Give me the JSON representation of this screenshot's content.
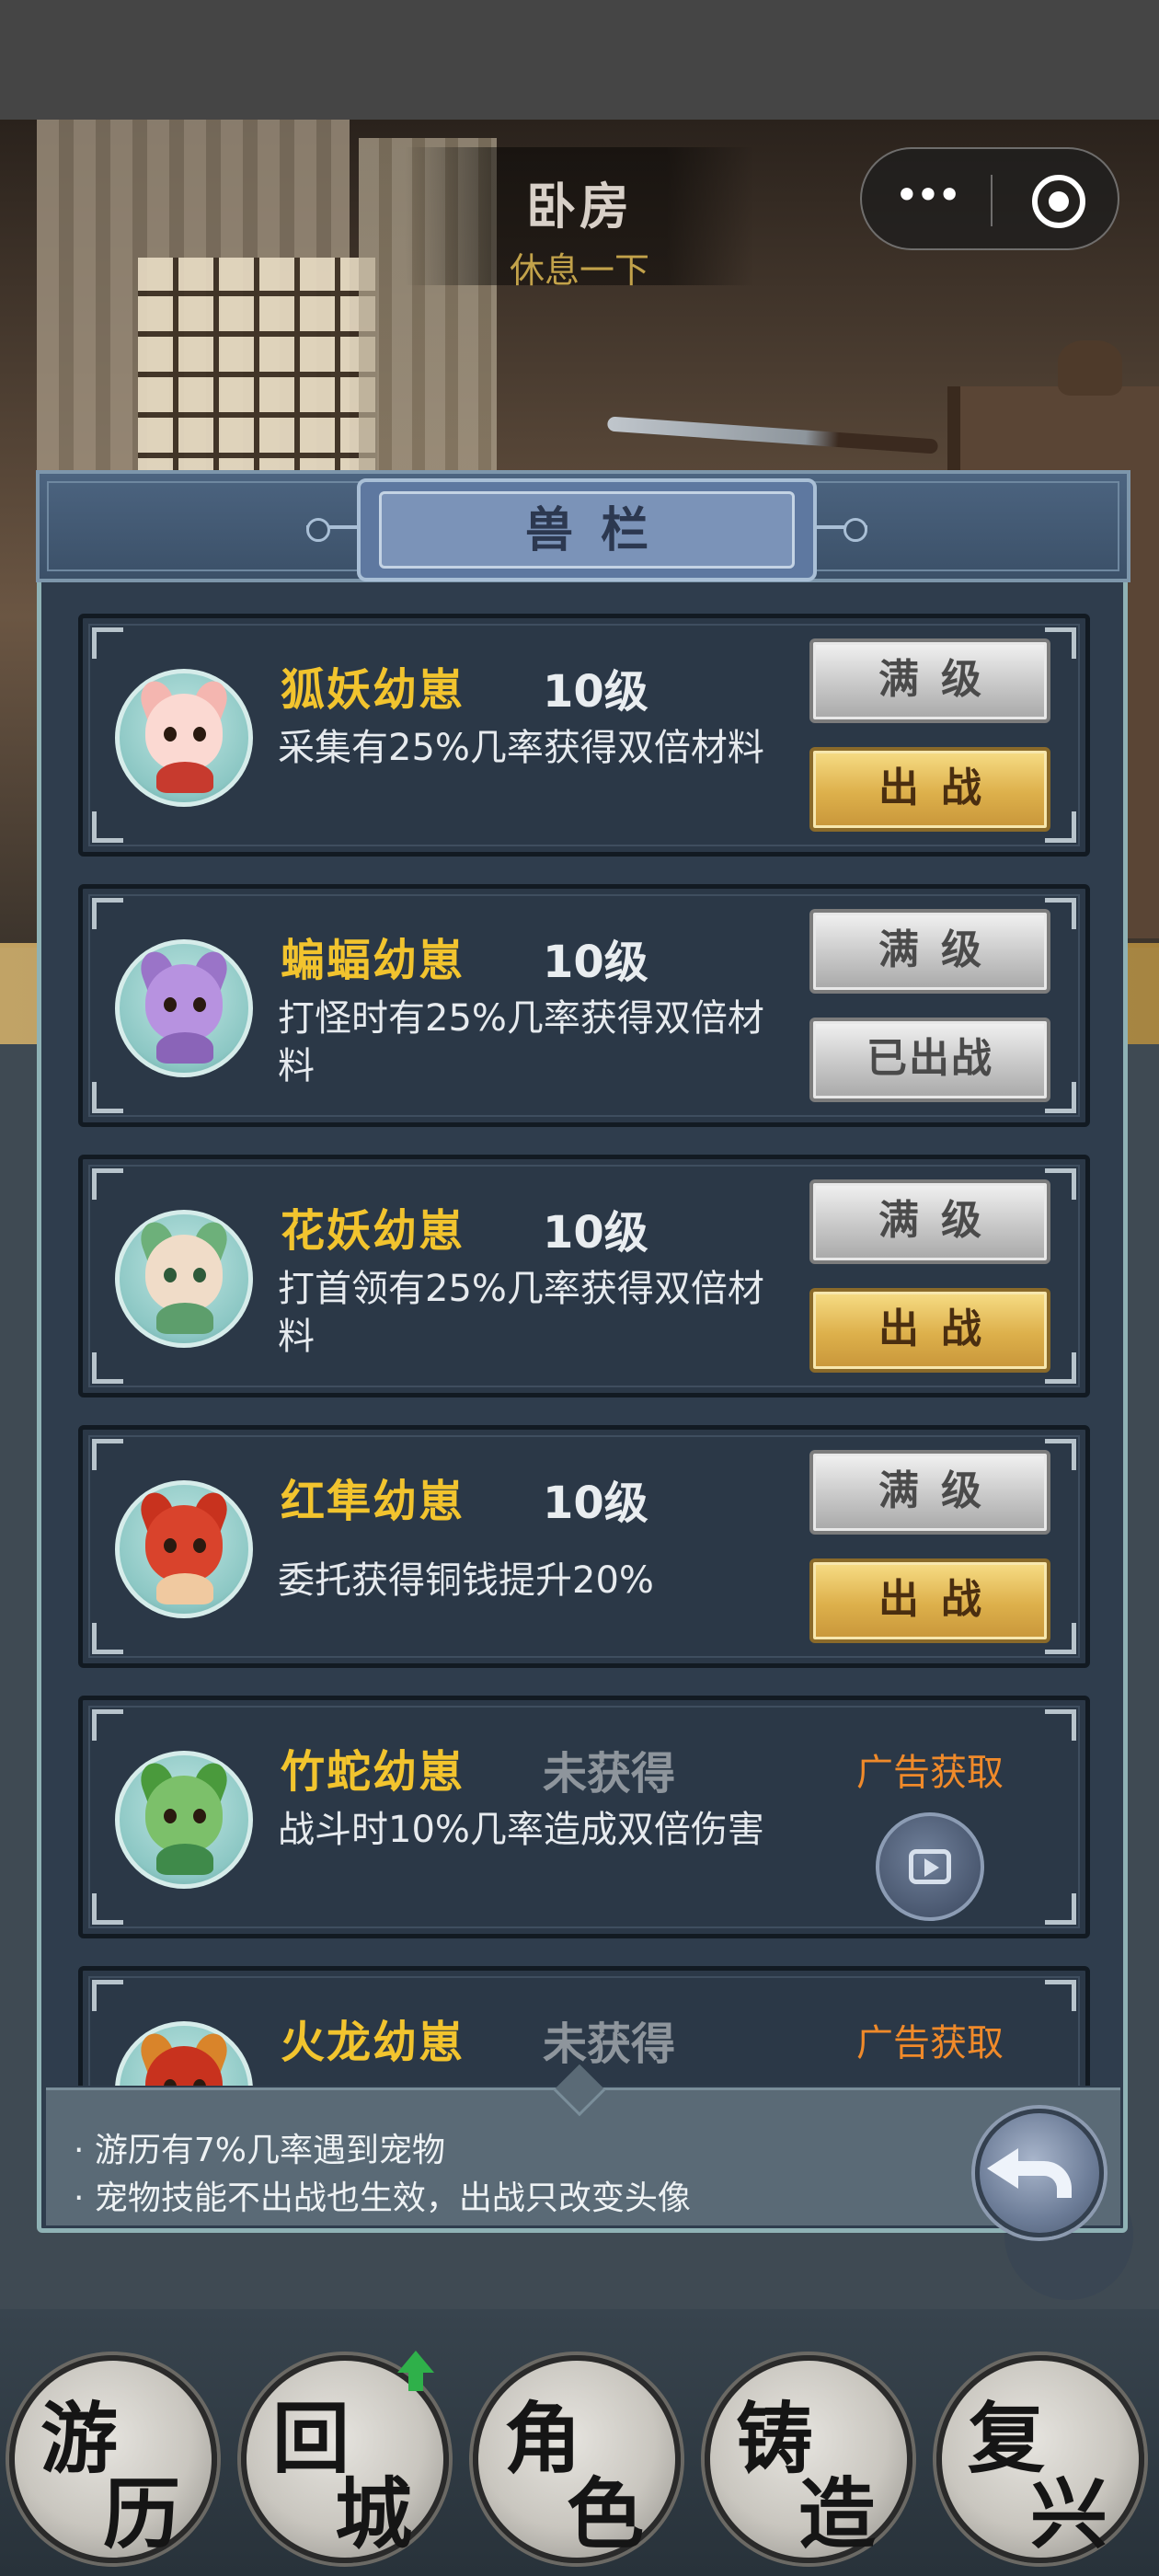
{
  "header": {
    "title": "卧房",
    "subtitle": "休息一下",
    "menu_icon": "more-dots-icon",
    "close_icon": "target-circle-icon"
  },
  "panel": {
    "title": "兽栏"
  },
  "pets": [
    {
      "name": "狐妖幼崽",
      "level": "10级",
      "desc": "采集有25%几率获得双倍材料",
      "top_button": "满级",
      "bottom_button": "出战",
      "bottom_state": "available",
      "avatar": "fox-icon"
    },
    {
      "name": "蝙蝠幼崽",
      "level": "10级",
      "desc": "打怪时有25%几率获得双倍材料",
      "top_button": "满级",
      "bottom_button": "已出战",
      "bottom_state": "active",
      "avatar": "bat-icon"
    },
    {
      "name": "花妖幼崽",
      "level": "10级",
      "desc": "打首领有25%几率获得双倍材料",
      "top_button": "满级",
      "bottom_button": "出战",
      "bottom_state": "available",
      "avatar": "flower-fairy-icon"
    },
    {
      "name": "红隼幼崽",
      "level": "10级",
      "desc": "委托获得铜钱提升20%",
      "top_button": "满级",
      "bottom_button": "出战",
      "bottom_state": "available",
      "avatar": "red-bird-icon"
    },
    {
      "name": "竹蛇幼崽",
      "level": "未获得",
      "desc": "战斗时10%几率造成双倍伤害",
      "ad_label": "广告获取",
      "avatar": "bamboo-snake-icon",
      "ad_icon": "video-play-icon"
    },
    {
      "name": "火龙幼崽",
      "level": "未获得",
      "ad_label": "广告获取",
      "avatar": "fire-dragon-icon"
    }
  ],
  "tips": [
    "· 游历有7%几率遇到宠物",
    "· 宠物技能不出战也生效，出战只改变头像"
  ],
  "nav": [
    {
      "label": "游历",
      "g1": "游",
      "g2": "历"
    },
    {
      "label": "回城",
      "g1": "回",
      "g2": "城",
      "badge": "green-up-arrow-icon"
    },
    {
      "label": "角色",
      "g1": "角",
      "g2": "色"
    },
    {
      "label": "铸造",
      "g1": "铸",
      "g2": "造"
    },
    {
      "label": "复兴",
      "g1": "复",
      "g2": "兴"
    }
  ],
  "colors": {
    "pet_name": "#f2c42e",
    "ad_label": "#f08a2a",
    "panel_bg": "#2f3d4d",
    "gold_button": "#ddb04b",
    "grey_button": "#c8c8c8"
  }
}
